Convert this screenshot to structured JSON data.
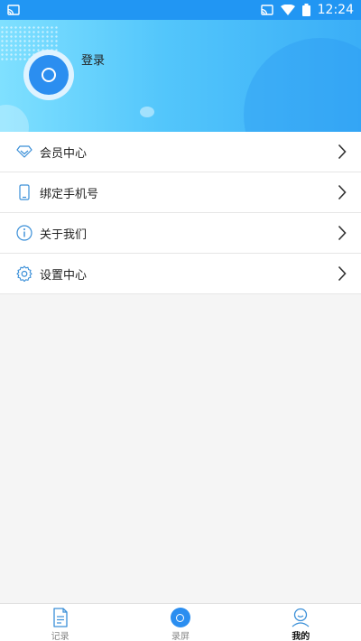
{
  "status_bar": {
    "time": "12:24",
    "icons": [
      "cast-icon",
      "wifi-icon",
      "battery-icon"
    ]
  },
  "header": {
    "login_label": "登录"
  },
  "menu": {
    "items": [
      {
        "label": "会员中心",
        "icon": "diamond-icon"
      },
      {
        "label": "绑定手机号",
        "icon": "phone-icon"
      },
      {
        "label": "关于我们",
        "icon": "info-icon"
      },
      {
        "label": "设置中心",
        "icon": "gear-icon"
      }
    ]
  },
  "tabbar": {
    "tabs": [
      {
        "label": "记录",
        "icon": "document-icon",
        "active": false
      },
      {
        "label": "录屏",
        "icon": "record-icon",
        "active": false
      },
      {
        "label": "我的",
        "icon": "user-icon",
        "active": true
      }
    ]
  },
  "colors": {
    "accent": "#2b8ef0",
    "status_bar": "#2196f3",
    "icon_stroke": "#3a8fd8"
  }
}
